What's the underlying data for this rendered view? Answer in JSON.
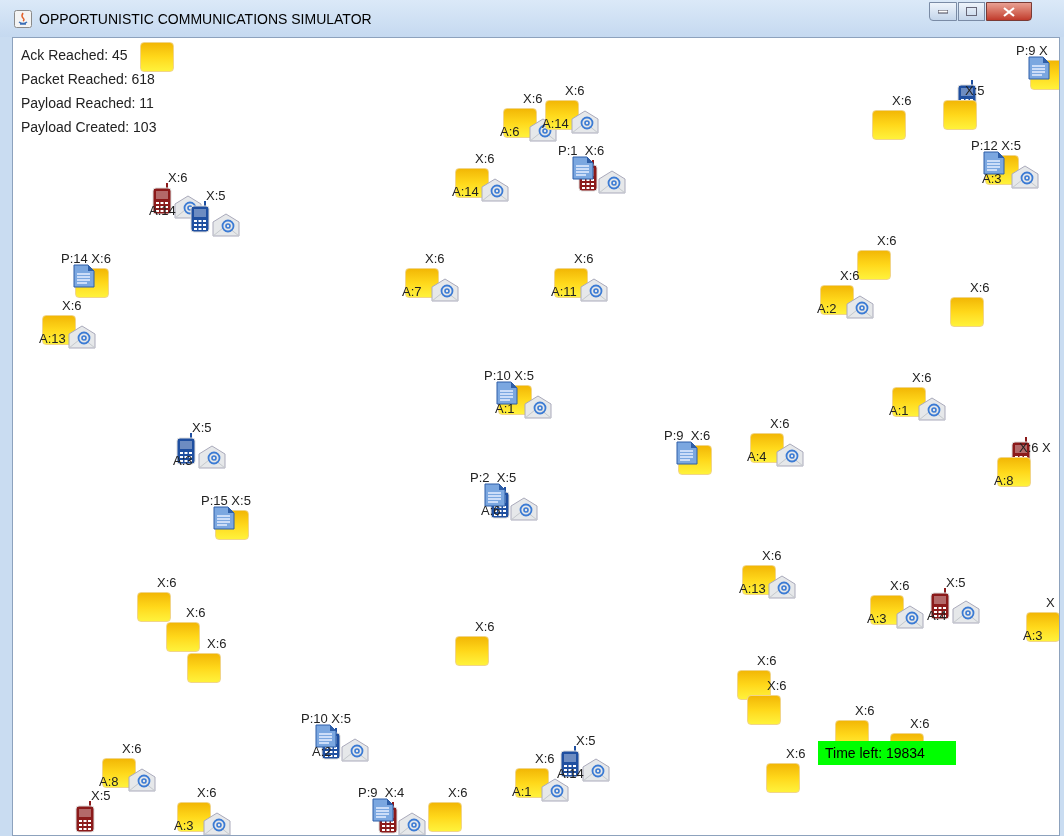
{
  "window": {
    "title": "OPPORTUNISTIC COMMUNICATIONS SIMULATOR"
  },
  "stats": [
    "Ack Reached: 45",
    "Packet Reached: 618",
    "Payload Reached: 11",
    "Payload Created: 103"
  ],
  "nodes": [
    {
      "kind": "folder",
      "mail": false
    },
    {
      "kind": "document",
      "top_label": "P:9 X",
      "mail": false
    },
    {
      "kind": "folder",
      "top_label": "X:6",
      "ack_label": "A:6",
      "mail": true
    },
    {
      "kind": "folder",
      "top_label": "X:6",
      "ack_label": "A:14",
      "mail": true
    },
    {
      "kind": "folder",
      "top_label": "X:6",
      "mail": false
    },
    {
      "kind": "folder_phone",
      "color": "#1f4fa0",
      "top_label": "X:5",
      "mail": false
    },
    {
      "kind": "folder",
      "top_label": "X:6",
      "ack_label": "A:14",
      "mail": true
    },
    {
      "kind": "document_phone",
      "color": "#8b1a1a",
      "top_label": "P:1  X:6",
      "mail": true
    },
    {
      "kind": "document",
      "top_label": "P:12 X:5",
      "ack_label": "A:3",
      "mail": true
    },
    {
      "kind": "phone",
      "color": "#8b1a1a",
      "top_label": "X:6",
      "ack_label": "A:14",
      "mail": true
    },
    {
      "kind": "phone",
      "color": "#1f4fa0",
      "top_label": "X:5",
      "mail": true
    },
    {
      "kind": "folder",
      "top_label": "X:6",
      "mail": false
    },
    {
      "kind": "document",
      "top_label": "P:14 X:6",
      "mail": false
    },
    {
      "kind": "folder",
      "top_label": "X:6",
      "ack_label": "A:7",
      "mail": true
    },
    {
      "kind": "folder",
      "top_label": "X:6",
      "ack_label": "A:11",
      "mail": true
    },
    {
      "kind": "folder",
      "top_label": "X:6",
      "ack_label": "A:2",
      "mail": true
    },
    {
      "kind": "folder",
      "top_label": "X:6",
      "mail": false
    },
    {
      "kind": "folder",
      "top_label": "X:6",
      "ack_label": "A:13",
      "mail": true
    },
    {
      "kind": "document",
      "top_label": "P:10 X:5",
      "ack_label": "A:1",
      "mail": true
    },
    {
      "kind": "folder",
      "top_label": "X:6",
      "ack_label": "A:1",
      "mail": true
    },
    {
      "kind": "phone",
      "color": "#1f4fa0",
      "top_label": "X:5",
      "ack_label": "A:3",
      "mail": true
    },
    {
      "kind": "document",
      "top_label": "P:9  X:6",
      "mail": false
    },
    {
      "kind": "folder",
      "top_label": "X:6",
      "ack_label": "A:4",
      "mail": true
    },
    {
      "kind": "folder_phone",
      "color": "#8b1a1a",
      "top_label": "X:6 X",
      "ack_label": "A:8",
      "mail": false
    },
    {
      "kind": "document",
      "top_label": "P:15 X:5",
      "mail": false
    },
    {
      "kind": "document_phone",
      "color": "#1f4fa0",
      "top_label": "P:2  X:5",
      "ack_label": "A:6",
      "mail": true
    },
    {
      "kind": "folder",
      "top_label": "X:6",
      "mail": false
    },
    {
      "kind": "folder",
      "top_label": "X:6",
      "ack_label": "A:13",
      "mail": true
    },
    {
      "kind": "folder",
      "top_label": "X:6",
      "ack_label": "A:3",
      "mail": true
    },
    {
      "kind": "phone",
      "color": "#8b1a1a",
      "top_label": "X:5",
      "ack_label": "A:4",
      "mail": true
    },
    {
      "kind": "folder",
      "top_label": "X",
      "ack_label": "A:3",
      "mail": false
    },
    {
      "kind": "folder",
      "top_label": "X:6",
      "mail": false
    },
    {
      "kind": "folder",
      "top_label": "X:6",
      "mail": false
    },
    {
      "kind": "folder",
      "top_label": "X:6",
      "mail": false
    },
    {
      "kind": "folder",
      "top_label": "X:6",
      "mail": false
    },
    {
      "kind": "folder",
      "top_label": "X:6",
      "mail": false
    },
    {
      "kind": "document_phone",
      "color": "#1f4fa0",
      "top_label": "P:10 X:5",
      "ack_label": "A:2",
      "mail": true
    },
    {
      "kind": "folder",
      "top_label": "X:6",
      "mail": false
    },
    {
      "kind": "folder",
      "top_label": "X:6",
      "mail": false
    },
    {
      "kind": "folder",
      "top_label": "X:6",
      "ack_label": "A:8",
      "mail": true
    },
    {
      "kind": "folder",
      "top_label": "X:6",
      "ack_label": "A:1",
      "mail": true
    },
    {
      "kind": "phone",
      "color": "#1f4fa0",
      "top_label": "X:5",
      "ack_label": "A:14",
      "mail": true
    },
    {
      "kind": "folder",
      "top_label": "X:6",
      "mail": false
    },
    {
      "kind": "phone",
      "color": "#8b1a1a",
      "top_label": "X:5",
      "mail": false
    },
    {
      "kind": "folder",
      "top_label": "X:6",
      "ack_label": "A:3",
      "mail": true
    },
    {
      "kind": "document_phone",
      "color": "#8b1a1a",
      "top_label": "P:9  X:4",
      "mail": true
    },
    {
      "kind": "folder",
      "top_label": "X:6",
      "mail": false
    }
  ],
  "timer": {
    "text": "Time left: 19834"
  }
}
